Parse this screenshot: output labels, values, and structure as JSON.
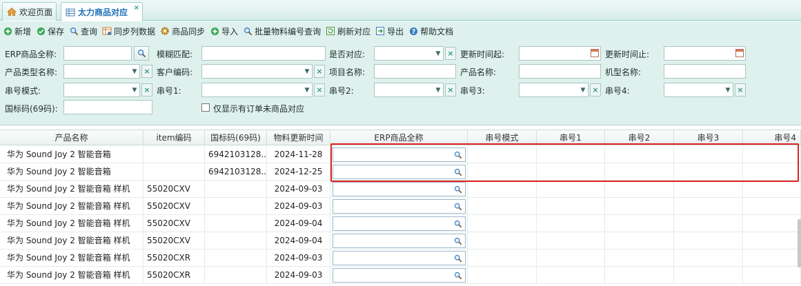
{
  "tabs": [
    {
      "label": "欢迎页面",
      "icon": "home-icon"
    },
    {
      "label": "太力商品对应",
      "icon": "table-icon",
      "close": "×"
    }
  ],
  "toolbar": [
    {
      "label": "新增",
      "icon": "add-icon"
    },
    {
      "label": "保存",
      "icon": "save-icon"
    },
    {
      "label": "查询",
      "icon": "search-icon"
    },
    {
      "label": "同步列数据",
      "icon": "sync-columns-icon"
    },
    {
      "label": "商品同步",
      "icon": "gear-icon"
    },
    {
      "label": "导入",
      "icon": "import-icon"
    },
    {
      "label": "批量物料编号查询",
      "icon": "search-icon"
    },
    {
      "label": "刷新对应",
      "icon": "refresh-icon"
    },
    {
      "label": "导出",
      "icon": "export-icon"
    },
    {
      "label": "帮助文档",
      "icon": "help-icon"
    }
  ],
  "filters": {
    "erp_name": {
      "label": "ERP商品全称:",
      "value": ""
    },
    "fuzzy": {
      "label": "模糊匹配:",
      "value": ""
    },
    "is_mapped": {
      "label": "是否对应:",
      "value": ""
    },
    "update_from": {
      "label": "更新时间起:",
      "value": ""
    },
    "update_to": {
      "label": "更新时间止:",
      "value": ""
    },
    "product_type": {
      "label": "产品类型名称:",
      "value": ""
    },
    "customer_code": {
      "label": "客户编码:",
      "value": ""
    },
    "project_name": {
      "label": "项目名称:",
      "value": ""
    },
    "product_name": {
      "label": "产品名称:",
      "value": ""
    },
    "model_name": {
      "label": "机型名称:",
      "value": ""
    },
    "serial_mode": {
      "label": "串号模式:",
      "value": ""
    },
    "serial1": {
      "label": "串号1:",
      "value": ""
    },
    "serial2": {
      "label": "串号2:",
      "value": ""
    },
    "serial3": {
      "label": "串号3:",
      "value": ""
    },
    "serial4": {
      "label": "串号4:",
      "value": ""
    },
    "gtin": {
      "label": "国标码(69码):",
      "value": ""
    },
    "only_unmapped": {
      "label": "仅显示有订单未商品对应",
      "checked": false
    }
  },
  "grid": {
    "columns": [
      "产品名称",
      "item编码",
      "国标码(69码)",
      "物料更新时间",
      "ERP商品全称",
      "串号模式",
      "串号1",
      "串号2",
      "串号3",
      "串号4"
    ],
    "rows": [
      {
        "product": "华为 Sound Joy 2 智能音箱",
        "item": "",
        "gtin": "6942103128...",
        "updated": "2024-11-28",
        "erp": ""
      },
      {
        "product": "华为 Sound Joy 2 智能音箱",
        "item": "",
        "gtin": "6942103128...",
        "updated": "2024-12-25",
        "erp": ""
      },
      {
        "product": "华为 Sound Joy 2 智能音箱 样机",
        "item": "55020CXV",
        "gtin": "",
        "updated": "2024-09-03",
        "erp": ""
      },
      {
        "product": "华为 Sound Joy 2 智能音箱 样机",
        "item": "55020CXV",
        "gtin": "",
        "updated": "2024-09-03",
        "erp": ""
      },
      {
        "product": "华为 Sound Joy 2 智能音箱 样机",
        "item": "55020CXV",
        "gtin": "",
        "updated": "2024-09-04",
        "erp": ""
      },
      {
        "product": "华为 Sound Joy 2 智能音箱 样机",
        "item": "55020CXV",
        "gtin": "",
        "updated": "2024-09-04",
        "erp": ""
      },
      {
        "product": "华为 Sound Joy 2 智能音箱 样机",
        "item": "55020CXR",
        "gtin": "",
        "updated": "2024-09-03",
        "erp": ""
      },
      {
        "product": "华为 Sound Joy 2 智能音箱 样机",
        "item": "55020CXR",
        "gtin": "",
        "updated": "2024-09-03",
        "erp": ""
      }
    ]
  },
  "colors": {
    "accent": "#1e6fb8",
    "panel": "#dff1ed",
    "highlight": "#e02020"
  }
}
